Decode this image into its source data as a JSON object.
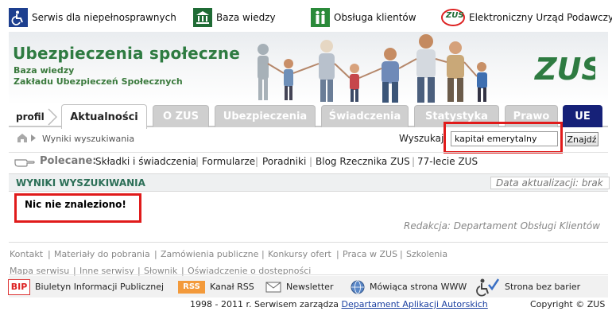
{
  "utility": {
    "disabled": "Serwis dla niepełnosprawnych",
    "knowledge": "Baza wiedzy",
    "customer": "Obsługa klientów",
    "epuap": "Elektroniczny Urząd Podawczy",
    "zus_badge": "ZUS"
  },
  "header": {
    "title": "Ubezpieczenia społeczne",
    "subtitle_1": "Baza wiedzy",
    "subtitle_2": "Zakładu Ubezpieczeń Społecznych",
    "logo_text": "ZUS"
  },
  "tabs": {
    "profil": "profil",
    "items": [
      "Aktualności",
      "O ZUS",
      "Ubezpieczenia",
      "Świadczenia",
      "Statystyka",
      "Prawo",
      "UE"
    ],
    "active": "Aktualności"
  },
  "breadcrumb": {
    "current": "Wyniki wyszukiwania"
  },
  "search": {
    "label": "Wyszukaj",
    "value": "kapitał emerytalny",
    "button": "Znajdź"
  },
  "recommended": {
    "label": "Polecane:",
    "links": [
      "Składki i świadczenia",
      "Formularze",
      "Poradniki",
      "Blog Rzecznika ZUS",
      "77-lecie ZUS"
    ]
  },
  "results": {
    "title": "WYNIKI WYSZUKIWANIA",
    "update_label": "Data aktualizacji: brak",
    "empty_message": "Nic nie znaleziono!",
    "editor": "Redakcja: Departament Obsługi Klientów"
  },
  "footer_links": {
    "row1": [
      "Kontakt",
      "Materiały do pobrania",
      "Zamówienia publiczne",
      "Konkursy ofert",
      "Praca w ZUS",
      "Szkolenia"
    ],
    "row2": [
      "Mapa serwisu",
      "Inne serwisy",
      "Słownik",
      "Oświadczenie o dostępności"
    ]
  },
  "footer_icons": {
    "bip_badge": "BIP",
    "bip": "Biuletyn Informacji Publicznej",
    "rss_badge": "RSS",
    "rss": "Kanał RSS",
    "newsletter": "Newsletter",
    "speaking": "Mówiąca strona WWW",
    "barrier": "Strona bez barier"
  },
  "footer": {
    "years": "1998 - 2011 r. Serwisem zarządza",
    "manager": "Departament Aplikacji Autorskich",
    "copyright": "Copyright © ZUS"
  },
  "colors": {
    "brand_green": "#2e7b41",
    "tab_inactive": "#cfcfcf",
    "tab_ue": "#162178",
    "highlight_red": "#e01b1b"
  }
}
